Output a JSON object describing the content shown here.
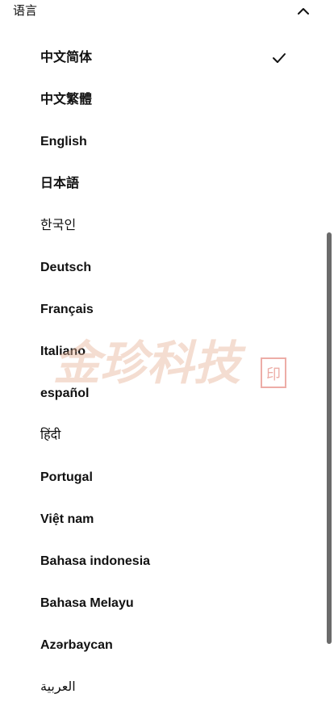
{
  "section": {
    "title": "语言",
    "toggle_icon": "chevron-up-icon"
  },
  "languages": [
    {
      "label": "中文简体",
      "selected": true
    },
    {
      "label": "中文繁體",
      "selected": false
    },
    {
      "label": "English",
      "selected": false
    },
    {
      "label": "日本語",
      "selected": false
    },
    {
      "label": "한국인",
      "selected": false
    },
    {
      "label": "Deutsch",
      "selected": false
    },
    {
      "label": "Français",
      "selected": false
    },
    {
      "label": "Italiano",
      "selected": false
    },
    {
      "label": "español",
      "selected": false
    },
    {
      "label": "हिंदी",
      "selected": false
    },
    {
      "label": "Portugal",
      "selected": false
    },
    {
      "label": "Việt nam",
      "selected": false
    },
    {
      "label": "Bahasa indonesia",
      "selected": false
    },
    {
      "label": "Bahasa Melayu",
      "selected": false
    },
    {
      "label": "Azərbaycan",
      "selected": false
    },
    {
      "label": "العربية",
      "selected": false
    }
  ],
  "watermark": {
    "text": "金珍科技",
    "seal_text": "印",
    "color": "#e7b49a",
    "seal_color": "#d9564a"
  },
  "colors": {
    "text": "#111111",
    "scrollbar": "#6b6b6b",
    "background": "#ffffff"
  }
}
